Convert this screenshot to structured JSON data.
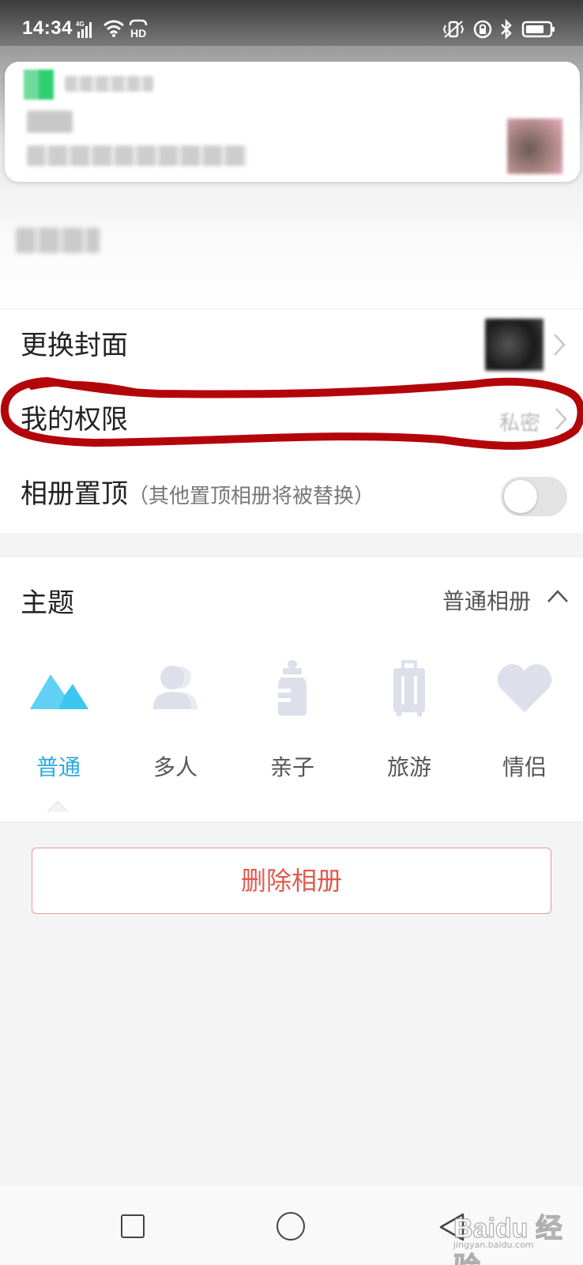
{
  "status_bar": {
    "time": "14:34",
    "signal_label": "4G",
    "hd_label": "HD"
  },
  "notification": {
    "app_icon": "app-icon-blurred",
    "app_name": "",
    "title": "",
    "body": ""
  },
  "album": {
    "name": ""
  },
  "settings": {
    "change_cover_label": "更换封面",
    "my_permission_label": "我的权限",
    "my_permission_value": "私密",
    "pin_album_label": "相册置顶",
    "pin_album_note": "（其他置顶相册将被替换）",
    "pin_album_on": false
  },
  "theme": {
    "title": "主题",
    "selected": "普通相册",
    "options": [
      {
        "label": "普通",
        "icon": "mountain-icon",
        "active": true
      },
      {
        "label": "多人",
        "icon": "people-icon",
        "active": false
      },
      {
        "label": "亲子",
        "icon": "baby-bottle-icon",
        "active": false
      },
      {
        "label": "旅游",
        "icon": "suitcase-icon",
        "active": false
      },
      {
        "label": "情侣",
        "icon": "heart-icon",
        "active": false
      }
    ]
  },
  "delete_button": {
    "label": "删除相册"
  },
  "navbar": {
    "icons": [
      "recent-apps-icon",
      "home-icon",
      "back-icon"
    ]
  },
  "watermark": {
    "brand": "Baidu 经验",
    "sub": "jingyan.baidu.com"
  },
  "colors": {
    "accent": "#29a9dd",
    "delete_red": "#e05a4e",
    "annotation_red": "#b3060a",
    "inactive_icon": "#dde0ea"
  }
}
